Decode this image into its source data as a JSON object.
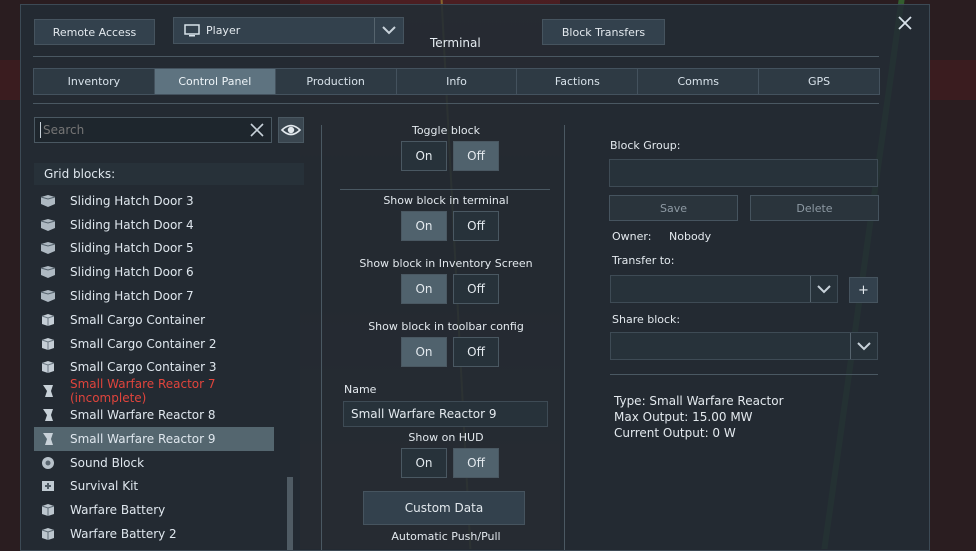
{
  "header": {
    "remote_access": "Remote Access",
    "player_select": "Player",
    "block_transfers": "Block Transfers",
    "terminal_title": "Terminal"
  },
  "tabs": [
    "Inventory",
    "Control Panel",
    "Production",
    "Info",
    "Factions",
    "Comms",
    "GPS"
  ],
  "active_tab": "Control Panel",
  "search": {
    "placeholder": "Search",
    "value": ""
  },
  "grid_blocks_header": "Grid blocks:",
  "blocks": [
    {
      "label": "Sliding Hatch Door 3",
      "icon": "hatch-door-icon",
      "state": "normal"
    },
    {
      "label": "Sliding Hatch Door 4",
      "icon": "hatch-door-icon",
      "state": "normal"
    },
    {
      "label": "Sliding Hatch Door 5",
      "icon": "hatch-door-icon",
      "state": "normal"
    },
    {
      "label": "Sliding Hatch Door 6",
      "icon": "hatch-door-icon",
      "state": "normal"
    },
    {
      "label": "Sliding Hatch Door 7",
      "icon": "hatch-door-icon",
      "state": "normal"
    },
    {
      "label": "Small Cargo Container",
      "icon": "cargo-container-icon",
      "state": "normal"
    },
    {
      "label": "Small Cargo Container 2",
      "icon": "cargo-container-icon",
      "state": "normal"
    },
    {
      "label": "Small Cargo Container 3",
      "icon": "cargo-container-icon",
      "state": "normal"
    },
    {
      "label": "Small Warfare Reactor 7 (incomplete)",
      "icon": "reactor-icon",
      "state": "incomplete"
    },
    {
      "label": "Small Warfare Reactor 8",
      "icon": "reactor-icon",
      "state": "normal"
    },
    {
      "label": "Small Warfare Reactor 9",
      "icon": "reactor-icon",
      "state": "selected"
    },
    {
      "label": "Sound Block",
      "icon": "sound-block-icon",
      "state": "normal"
    },
    {
      "label": "Survival Kit",
      "icon": "survival-kit-icon",
      "state": "normal"
    },
    {
      "label": "Warfare Battery",
      "icon": "battery-icon",
      "state": "normal"
    },
    {
      "label": "Warfare Battery 2",
      "icon": "battery-icon",
      "state": "normal"
    }
  ],
  "controls": {
    "toggle_block": {
      "label": "Toggle block",
      "on": "On",
      "off": "Off",
      "value": "Off"
    },
    "show_terminal": {
      "label": "Show block in terminal",
      "on": "On",
      "off": "Off",
      "value": "On"
    },
    "show_inventory": {
      "label": "Show block in Inventory Screen",
      "on": "On",
      "off": "Off",
      "value": "On"
    },
    "show_toolbar": {
      "label": "Show block in toolbar config",
      "on": "On",
      "off": "Off",
      "value": "On"
    },
    "name_label": "Name",
    "name_value": "Small Warfare Reactor 9",
    "show_hud": {
      "label": "Show on HUD",
      "on": "On",
      "off": "Off",
      "value": "Off"
    },
    "custom_data": "Custom Data",
    "auto_push_pull": "Automatic Push/Pull"
  },
  "right": {
    "block_group_label": "Block Group:",
    "block_group_value": "",
    "save": "Save",
    "delete": "Delete",
    "owner_label": "Owner:",
    "owner_value": "Nobody",
    "transfer_label": "Transfer to:",
    "transfer_add": "+",
    "share_label": "Share block:",
    "info_type": "Type: Small Warfare Reactor",
    "info_max": "Max Output: 15.00 MW",
    "info_current": "Current Output: 0 W"
  },
  "colors": {
    "accent": "#5e7380",
    "warning": "#e0443c",
    "selected_row": "#54666f"
  }
}
